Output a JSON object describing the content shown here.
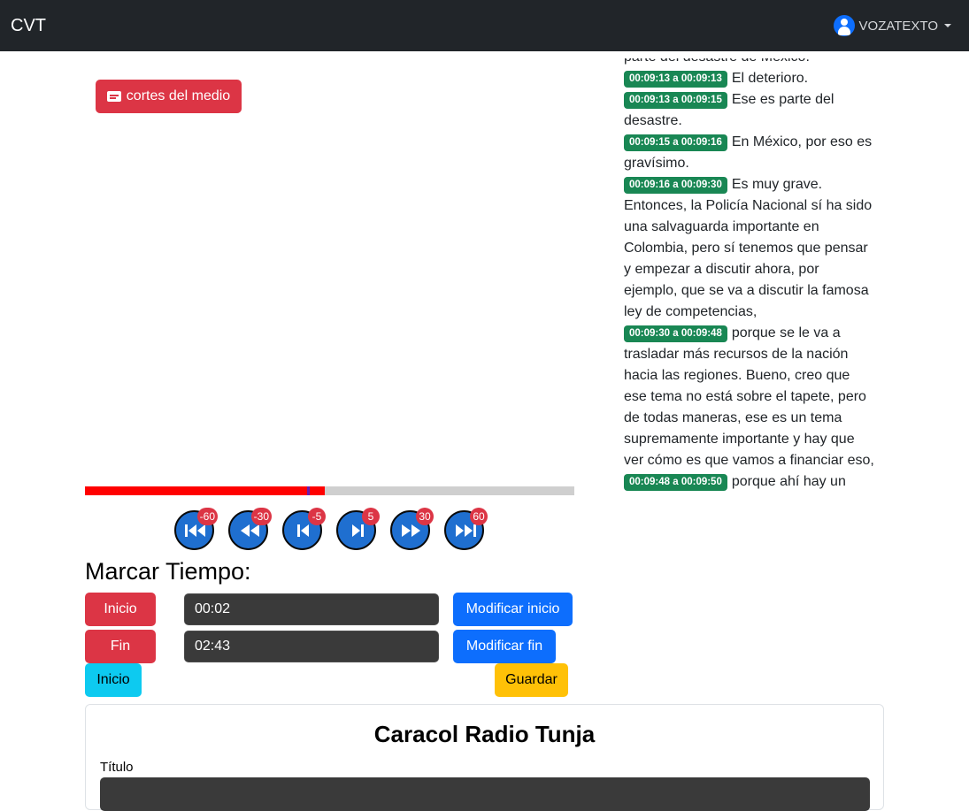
{
  "navbar": {
    "brand": "CVT",
    "user": "VOZATEXTO"
  },
  "cortes_button": "cortes del medio",
  "player": {
    "progress_fraction": 0.49
  },
  "controls": [
    {
      "name": "skip-back-60",
      "badge": "-60"
    },
    {
      "name": "skip-back-30",
      "badge": "-30"
    },
    {
      "name": "skip-back-5",
      "badge": "-5"
    },
    {
      "name": "skip-forward-5",
      "badge": "5"
    },
    {
      "name": "skip-forward-30",
      "badge": "30"
    },
    {
      "name": "skip-forward-60",
      "badge": "60"
    }
  ],
  "marcar": {
    "title": "Marcar Tiempo:",
    "inicio_label": "Inicio",
    "fin_label": "Fin",
    "inicio_value": "00:02",
    "fin_value": "02:43",
    "modificar_inicio": "Modificar inicio",
    "modificar_fin": "Modificar fin",
    "inicio_info": "Inicio",
    "guardar": "Guardar"
  },
  "transcript": {
    "lead": "parte del desastre de México.",
    "entries": [
      {
        "time": "00:09:13 a 00:09:13",
        "text": "El deterioro."
      },
      {
        "time": "00:09:13 a 00:09:15",
        "text": "Ese es parte del desastre."
      },
      {
        "time": "00:09:15 a 00:09:16",
        "text": "En México, por eso es gravísimo."
      },
      {
        "time": "00:09:16 a 00:09:30",
        "text": "Es muy grave. Entonces, la Policía Nacional sí ha sido una salvaguarda importante en Colombia, pero sí tenemos que pensar y empezar a discutir ahora, por ejemplo, que se va a discutir la famosa ley de competencias,"
      },
      {
        "time": "00:09:30 a 00:09:48",
        "text": "porque se le va a trasladar más recursos de la nación hacia las regiones. Bueno, creo que ese tema no está sobre el tapete, pero de todas maneras, ese es un tema supremamente importante y hay que ver cómo es que vamos a financiar eso,"
      },
      {
        "time": "00:09:48 a 00:09:50",
        "text": "porque ahí hay un"
      }
    ]
  },
  "card": {
    "title": "Caracol Radio Tunja",
    "titulo_label": "Título"
  },
  "colors": {
    "navbar": "#212529",
    "danger": "#dc3545",
    "primary": "#0d6efd",
    "info": "#0dcaf0",
    "warning": "#ffc107",
    "badge": "#198754"
  }
}
